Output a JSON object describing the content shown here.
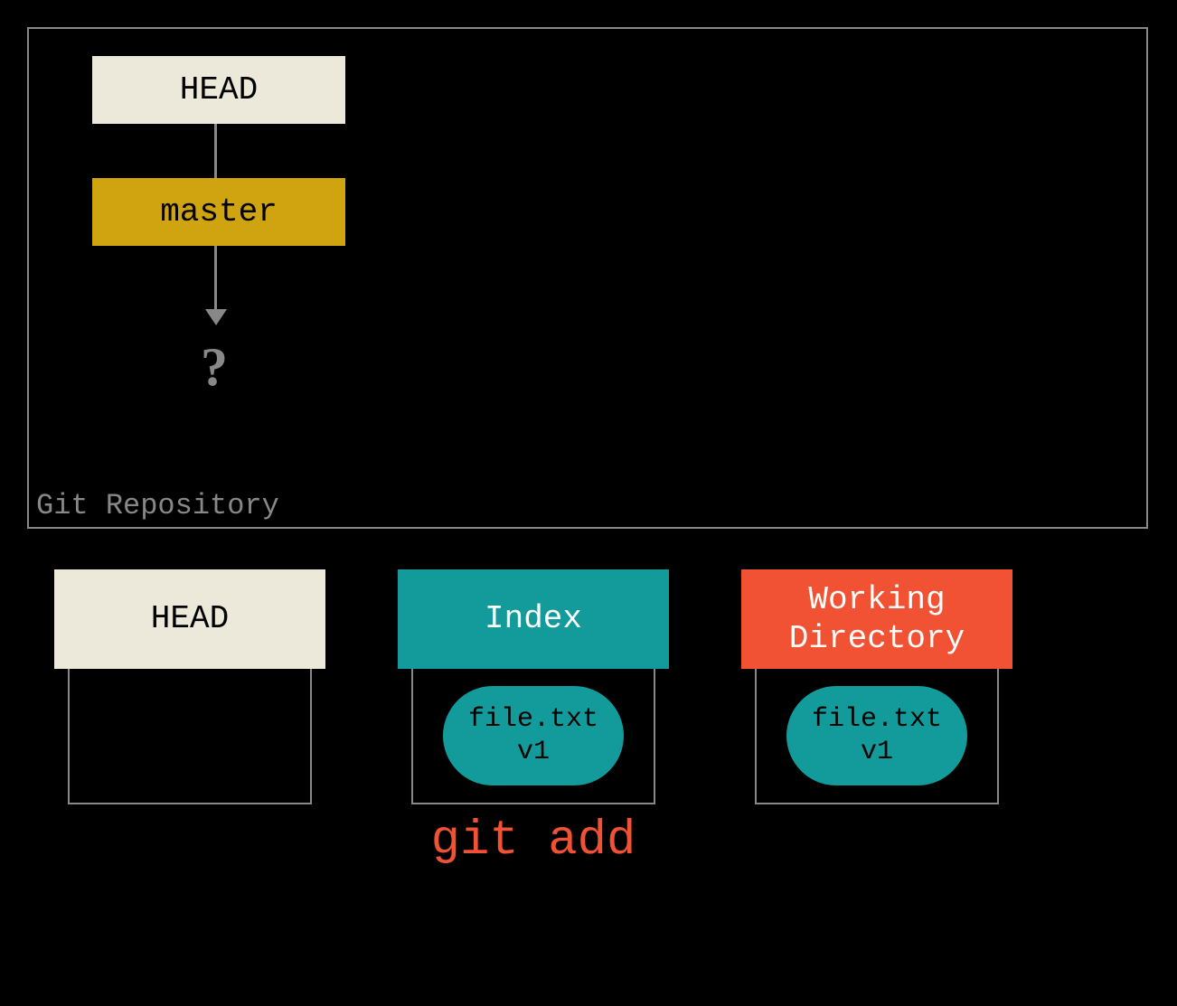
{
  "repo": {
    "label": "Git Repository",
    "head_label": "HEAD",
    "branch_label": "master",
    "unknown_marker": "?"
  },
  "trees": {
    "head": {
      "header": "HEAD",
      "file": null
    },
    "index": {
      "header": "Index",
      "file_name": "file.txt",
      "file_version": "v1"
    },
    "wd": {
      "header_line1": "Working",
      "header_line2": "Directory",
      "file_name": "file.txt",
      "file_version": "v1"
    }
  },
  "command": "git add"
}
